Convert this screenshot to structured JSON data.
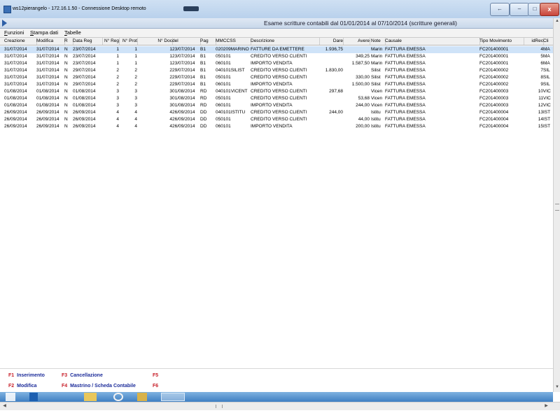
{
  "rdp_window": {
    "title": "ws12pierangelo - 172.16.1.50 - Connessione Desktop remoto",
    "close_glyph": "x",
    "restore_glyph": "←",
    "min_glyph": "–",
    "max_glyph": "□"
  },
  "app": {
    "title": "Esame scritture contabili dal 01/01/2014 al 07/10/2014 (scritture generali)",
    "menu": [
      "Funzioni",
      "Stampa dati",
      "Tabelle"
    ]
  },
  "grid": {
    "columns": [
      "Creazione",
      "Modifica",
      "R",
      "Data Reg",
      "N° Reg",
      "N° Prot",
      "N° Doc",
      "del",
      "Pag",
      "MMCCSS",
      "Descrizione",
      "Dare",
      "Avere",
      "Note",
      "Causale",
      "Tipo Movimento",
      "idRec",
      "Cli"
    ],
    "rows": [
      [
        "31/07/2014",
        "31/07/2014",
        "N",
        "23/07/2014",
        "1",
        "1",
        "1",
        "23/07/2014",
        "B1",
        "020209MARINO",
        "FATTURE DA EMETTERE",
        "1.936,75",
        "",
        "Marin",
        "FATTURA EMESSA",
        "FC201400001",
        "4",
        "MA"
      ],
      [
        "31/07/2014",
        "31/07/2014",
        "N",
        "23/07/2014",
        "1",
        "1",
        "1",
        "23/07/2014",
        "B1",
        "050101",
        "CREDITO VERSO CLIENTI",
        "",
        "349,25",
        "Marin",
        "FATTURA EMESSA",
        "FC201400001",
        "5",
        "MA"
      ],
      [
        "31/07/2014",
        "31/07/2014",
        "N",
        "23/07/2014",
        "1",
        "1",
        "1",
        "23/07/2014",
        "B1",
        "060101",
        "IMPORTO VENDITA",
        "",
        "1.587,50",
        "Marin",
        "FATTURA EMESSA",
        "FC201400001",
        "6",
        "MA"
      ],
      [
        "31/07/2014",
        "31/07/2014",
        "N",
        "29/07/2014",
        "2",
        "2",
        "2",
        "29/07/2014",
        "B1",
        "040101SILIST",
        "CREDITO VERSO CLIENTI",
        "1.830,00",
        "",
        "Silist",
        "FATTURA EMESSA",
        "FC201400002",
        "7",
        "SIL"
      ],
      [
        "31/07/2014",
        "31/07/2014",
        "N",
        "29/07/2014",
        "2",
        "2",
        "2",
        "29/07/2014",
        "B1",
        "050101",
        "CREDITO VERSO CLIENTI",
        "",
        "330,00",
        "Silist",
        "FATTURA EMESSA",
        "FC201400002",
        "8",
        "SIL"
      ],
      [
        "31/07/2014",
        "31/07/2014",
        "N",
        "29/07/2014",
        "2",
        "2",
        "2",
        "29/07/2014",
        "B1",
        "060101",
        "IMPORTO VENDITA",
        "",
        "1.500,00",
        "Silist",
        "FATTURA EMESSA",
        "FC201400002",
        "9",
        "SIL"
      ],
      [
        "01/08/2014",
        "01/08/2014",
        "N",
        "01/08/2014",
        "3",
        "3",
        "3",
        "01/08/2014",
        "RD",
        "040101VICENT",
        "CREDITO VERSO CLIENTI",
        "297,68",
        "",
        "Vicen",
        "FATTURA EMESSA",
        "FC201400003",
        "10",
        "VIC"
      ],
      [
        "01/08/2014",
        "01/08/2014",
        "N",
        "01/08/2014",
        "3",
        "3",
        "3",
        "01/08/2014",
        "RD",
        "050101",
        "CREDITO VERSO CLIENTI",
        "",
        "53,68",
        "Vicen",
        "FATTURA EMESSA",
        "FC201400003",
        "11",
        "VIC"
      ],
      [
        "01/08/2014",
        "01/08/2014",
        "N",
        "01/08/2014",
        "3",
        "3",
        "3",
        "01/08/2014",
        "RD",
        "060101",
        "IMPORTO VENDITA",
        "",
        "244,00",
        "Vicen",
        "FATTURA EMESSA",
        "FC201400003",
        "12",
        "VIC"
      ],
      [
        "26/09/2014",
        "26/09/2014",
        "N",
        "26/09/2014",
        "4",
        "4",
        "4",
        "26/09/2014",
        "DD",
        "040101ISTITU",
        "CREDITO VERSO CLIENTI",
        "244,00",
        "",
        "Istitu",
        "FATTURA EMESSA",
        "FC201400004",
        "13",
        "IST"
      ],
      [
        "26/09/2014",
        "26/09/2014",
        "N",
        "26/09/2014",
        "4",
        "4",
        "4",
        "26/09/2014",
        "DD",
        "050101",
        "CREDITO VERSO CLIENTI",
        "",
        "44,00",
        "Istitu",
        "FATTURA EMESSA",
        "FC201400004",
        "14",
        "IST"
      ],
      [
        "26/09/2014",
        "26/09/2014",
        "N",
        "26/09/2014",
        "4",
        "4",
        "4",
        "26/09/2014",
        "DD",
        "060101",
        "IMPORTO VENDITA",
        "",
        "200,00",
        "Istitu",
        "FATTURA EMESSA",
        "FC201400004",
        "15",
        "IST"
      ]
    ],
    "selected_row": 0
  },
  "function_keys": [
    {
      "key": "F1",
      "label": "Inserimento"
    },
    {
      "key": "F2",
      "label": "Modifica"
    },
    {
      "key": "F3",
      "label": "Cancellazione"
    },
    {
      "key": "F4",
      "label": "Mastrino / Scheda Contabile"
    },
    {
      "key": "F5",
      "label": ""
    },
    {
      "key": "F6",
      "label": ""
    }
  ],
  "taskbar": {
    "icons": [
      "windows-start-icon",
      "file-explorer-icon",
      "folder-icon",
      "internet-explorer-icon",
      "app-icon",
      "remote-desktop-icon"
    ]
  }
}
